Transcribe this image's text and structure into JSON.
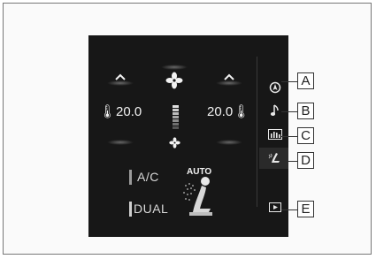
{
  "climate": {
    "left_temp": "20.0",
    "right_temp": "20.0",
    "ac_label": "A/C",
    "dual_label": "DUAL",
    "auto_label": "AUTO"
  },
  "sidebar": {
    "items": [
      {
        "icon": "navigation-icon"
      },
      {
        "icon": "music-note-icon"
      },
      {
        "icon": "equalizer-icon"
      },
      {
        "icon": "seat-climate-icon"
      },
      {
        "icon": "media-player-icon"
      }
    ]
  },
  "callouts": [
    "A",
    "B",
    "C",
    "D",
    "E"
  ]
}
